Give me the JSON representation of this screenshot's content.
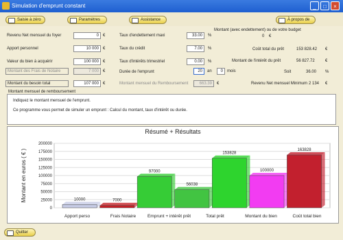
{
  "window": {
    "title": "Simulation d'emprunt constant",
    "minimize": "_",
    "maximize": "□",
    "close": "×"
  },
  "toolbar": {
    "new_label": "Saisie à zéro",
    "params_label": "Paramètres",
    "help_label": "Assistance",
    "about_label": "À propos de"
  },
  "form": {
    "left": [
      {
        "label": "Revenu Net mensuel du foyer",
        "value": "0",
        "unit": "€"
      },
      {
        "label": "Apport personnel",
        "value": "10 000",
        "unit": "€"
      },
      {
        "label": "Valeur du bien à acquérir",
        "value": "100 000",
        "unit": "€"
      },
      {
        "label": "Montant des Frais de Notaire",
        "value": "7 000",
        "unit": "€"
      },
      {
        "label": "Montant du besoin total",
        "value": "107 000",
        "unit": "€"
      }
    ],
    "mid": [
      {
        "label": "Taux d'endettement maxi",
        "value": "33.00",
        "unit": "%"
      },
      {
        "label": "Taux du crédit",
        "value": "7.00",
        "unit": "%"
      },
      {
        "label": "Taux d'intérêts trimestriel",
        "value": "0.00",
        "unit": "%"
      },
      {
        "label": "Durée de l'emprunt",
        "value": "20",
        "unit": "an",
        "unit2": "mois",
        "value2": "0"
      },
      {
        "label": "Montant mensuel du Remboursement",
        "value": "663.39",
        "unit": "€"
      }
    ],
    "right_header": "Montant (avec endettement) ou de votre budget",
    "right_header_value": "0",
    "right_header_unit": "€",
    "right": [
      {
        "label": "Coût total du prêt",
        "value": "153 828.42",
        "unit": "€"
      },
      {
        "label": "Montant de l'intérêt du prêt",
        "value": "56 827.72",
        "unit": "€"
      },
      {
        "label": "Soit",
        "value": "36.00",
        "unit": "%"
      },
      {
        "label": "Revenu Net mensuel Minimum",
        "value": "2 134",
        "unit": "€"
      }
    ]
  },
  "info": {
    "tab_label": "Montant mensuel de remboursement",
    "line1": "Indiquez le montant mensuel de l'emprunt.",
    "line2": "Ce programme vous permet de simuler un emprunt : Calcul du montant, taux d'intérêt ou durée."
  },
  "chart_data": {
    "type": "bar",
    "title": "Résumé + Résultats",
    "ylabel": "Montant en euros ( € )",
    "ylim": [
      0,
      200000
    ],
    "yticks": [
      "0",
      "25000",
      "50000",
      "75000",
      "100000",
      "125000",
      "150000",
      "175000",
      "200000"
    ],
    "categories": [
      "Apport perso",
      "Frais Notaire",
      "Emprunt + intérêt prêt",
      "Total prêt",
      "Montant du bien",
      "Coût total bien"
    ],
    "values": [
      10000,
      7000,
      97000,
      56038,
      153828,
      100000,
      163828
    ],
    "value_labels": [
      "10000",
      "7000",
      "97000",
      "56038",
      "153828",
      "100000",
      "163828"
    ],
    "colors": [
      "#c7cce6",
      "#c41f26",
      "#36cc36",
      "#42c442",
      "#2ed42e",
      "#f23cf2",
      "#c2202e"
    ]
  },
  "footer": {
    "quit_label": "Quitter"
  }
}
